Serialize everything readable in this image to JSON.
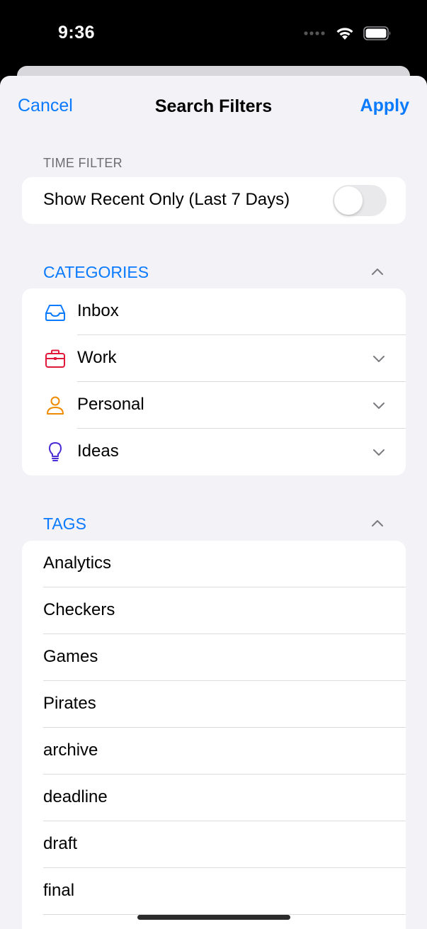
{
  "status_bar": {
    "time": "9:36"
  },
  "nav": {
    "cancel_label": "Cancel",
    "title": "Search Filters",
    "apply_label": "Apply"
  },
  "time_filter": {
    "caption": "TIME FILTER",
    "toggle_label": "Show Recent Only (Last 7 Days)",
    "toggle_on": false
  },
  "categories": {
    "header": "CATEGORIES",
    "items": [
      {
        "label": "Inbox",
        "icon": "tray-icon",
        "color": "#0a7aff",
        "expandable": false
      },
      {
        "label": "Work",
        "icon": "briefcase-icon",
        "color": "#e0193a",
        "expandable": true
      },
      {
        "label": "Personal",
        "icon": "person-icon",
        "color": "#f08a00",
        "expandable": true
      },
      {
        "label": "Ideas",
        "icon": "lightbulb-icon",
        "color": "#4a2bd6",
        "expandable": true
      }
    ]
  },
  "tags": {
    "header": "TAGS",
    "items": [
      "Analytics",
      "Checkers",
      "Games",
      "Pirates",
      "archive",
      "deadline",
      "draft",
      "final"
    ]
  },
  "colors": {
    "accent": "#0a7aff",
    "background": "#f2f2f7"
  }
}
